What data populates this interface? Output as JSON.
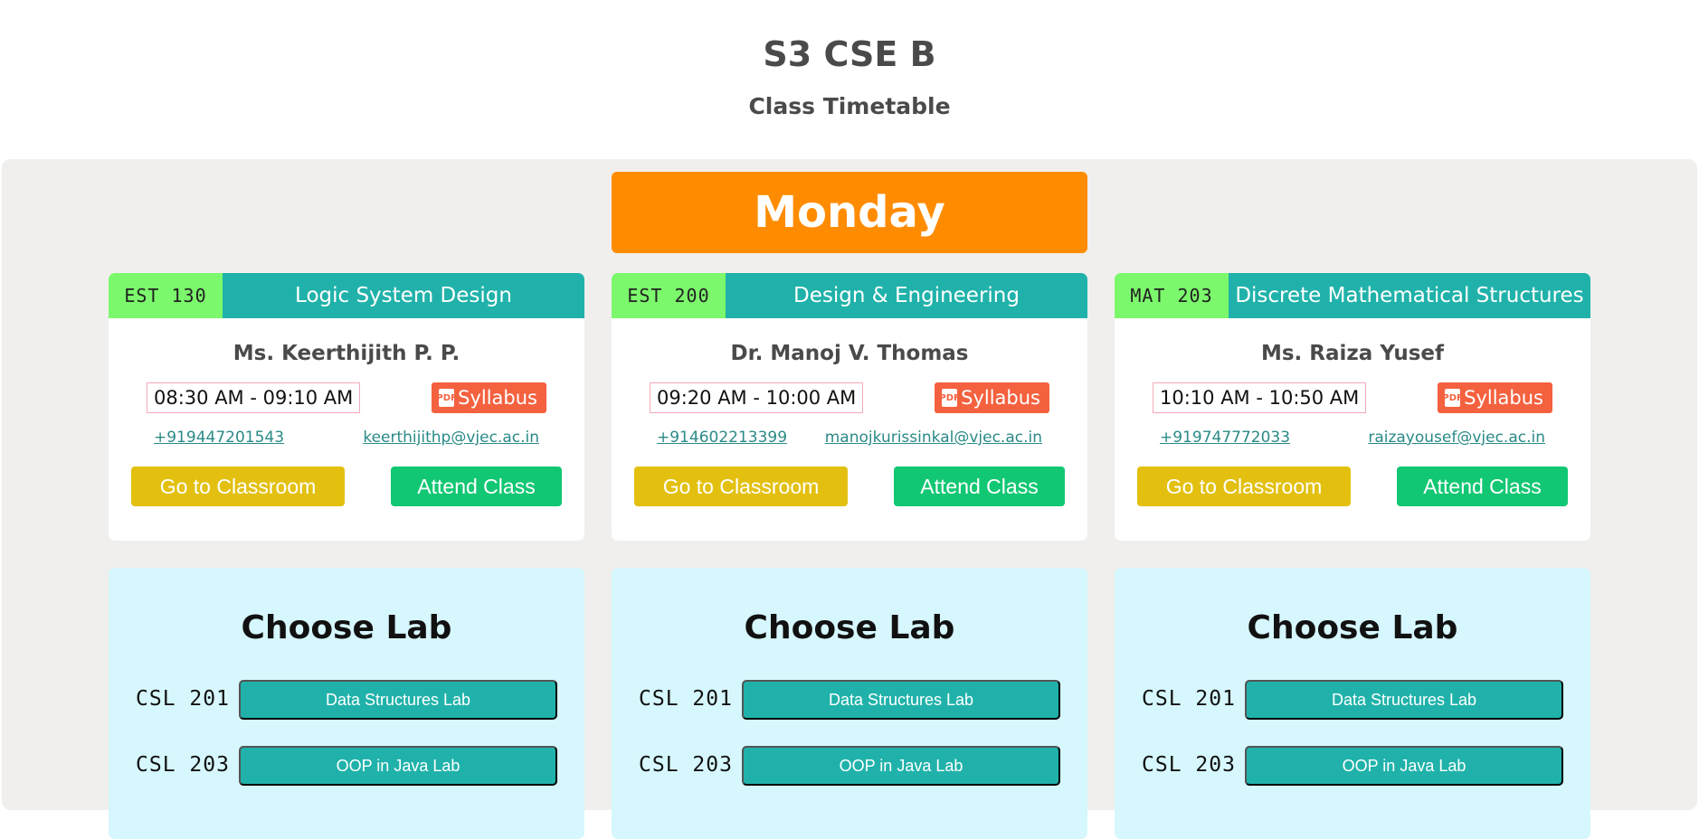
{
  "header": {
    "title": "S3 CSE B",
    "subtitle": "Class Timetable"
  },
  "day": "Monday",
  "colors": {
    "day_banner": "#ff8c00",
    "code_tag": "#7cf86c",
    "subject_bar": "#20b2aa",
    "syllabus": "#f4613f",
    "classroom_button": "#e3c010",
    "attend_button": "#12c773",
    "lab_panel": "#d6f7fd"
  },
  "classes": [
    {
      "code": "EST 130",
      "subject": "Logic System Design",
      "teacher": "Ms. Keerthijith P. P.",
      "time": "08:30 AM - 09:10 AM",
      "syllabus_label": "Syllabus",
      "phone": "+919447201543",
      "email": "keerthijithp@vjec.ac.in",
      "classroom_label": "Go to Classroom",
      "attend_label": "Attend Class"
    },
    {
      "code": "EST 200",
      "subject": "Design & Engineering",
      "teacher": "Dr. Manoj V. Thomas",
      "time": "09:20 AM - 10:00 AM",
      "syllabus_label": "Syllabus",
      "phone": "+914602213399",
      "email": "manojkurissinkal@vjec.ac.in",
      "classroom_label": "Go to Classroom",
      "attend_label": "Attend Class"
    },
    {
      "code": "MAT 203",
      "subject": "Discrete Mathematical Structures",
      "teacher": "Ms. Raiza Yusef",
      "time": "10:10 AM - 10:50 AM",
      "syllabus_label": "Syllabus",
      "phone": "+919747772033",
      "email": "raizayousef@vjec.ac.in",
      "classroom_label": "Go to Classroom",
      "attend_label": "Attend Class"
    }
  ],
  "labs": [
    {
      "title": "Choose Lab",
      "items": [
        {
          "code": "CSL 201",
          "name": "Data Structures Lab"
        },
        {
          "code": "CSL 203",
          "name": "OOP in Java Lab"
        }
      ]
    },
    {
      "title": "Choose Lab",
      "items": [
        {
          "code": "CSL 201",
          "name": "Data Structures Lab"
        },
        {
          "code": "CSL 203",
          "name": "OOP in Java Lab"
        }
      ]
    },
    {
      "title": "Choose Lab",
      "items": [
        {
          "code": "CSL 201",
          "name": "Data Structures Lab"
        },
        {
          "code": "CSL 203",
          "name": "OOP in Java Lab"
        }
      ]
    }
  ]
}
